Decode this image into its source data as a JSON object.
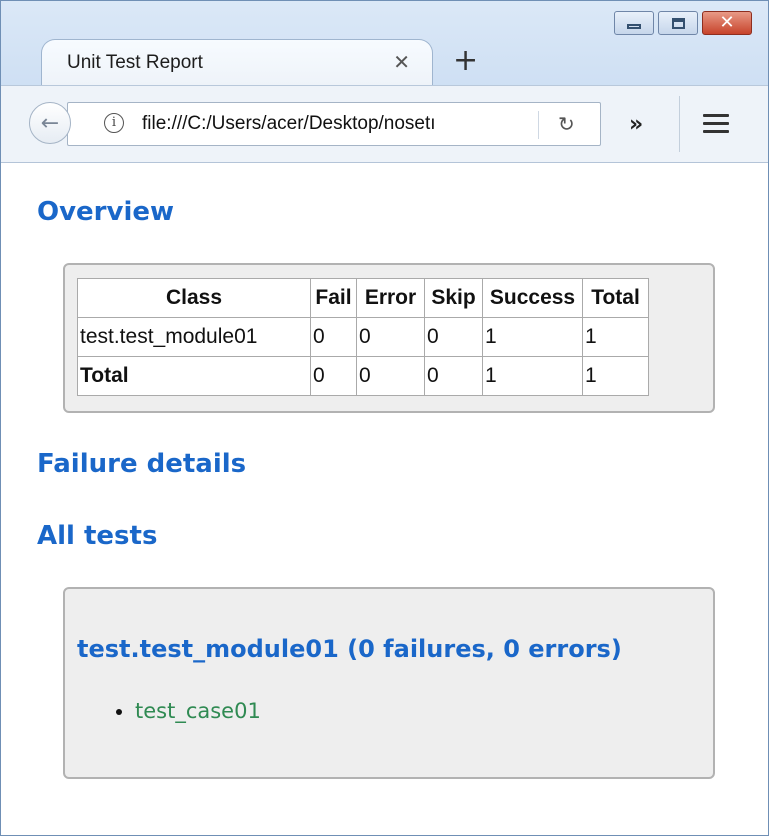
{
  "window": {
    "tab_title": "Unit Test Report",
    "tab_close": "✕",
    "new_tab": "+",
    "caption": {
      "close": "✕"
    }
  },
  "navbar": {
    "back": "←",
    "info": "i",
    "url": "file:///C:/Users/acer/Desktop/nosetı",
    "reload": "↻",
    "overflow": "»"
  },
  "report": {
    "overview_title": "Overview",
    "summary_table": {
      "headers": [
        "Class",
        "Fail",
        "Error",
        "Skip",
        "Success",
        "Total"
      ],
      "rows": [
        [
          "test.test_module01",
          "0",
          "0",
          "0",
          "1",
          "1"
        ],
        [
          "Total",
          "0",
          "0",
          "0",
          "1",
          "1"
        ]
      ]
    },
    "failure_title": "Failure details",
    "all_tests_title": "All tests",
    "module_heading": "test.test_module01 (0 failures, 0 errors)",
    "tests": [
      "test_case01"
    ]
  },
  "colors": {
    "heading": "#1a67c9",
    "test_link": "#2f8a52",
    "box_bg": "#eeeeee"
  }
}
